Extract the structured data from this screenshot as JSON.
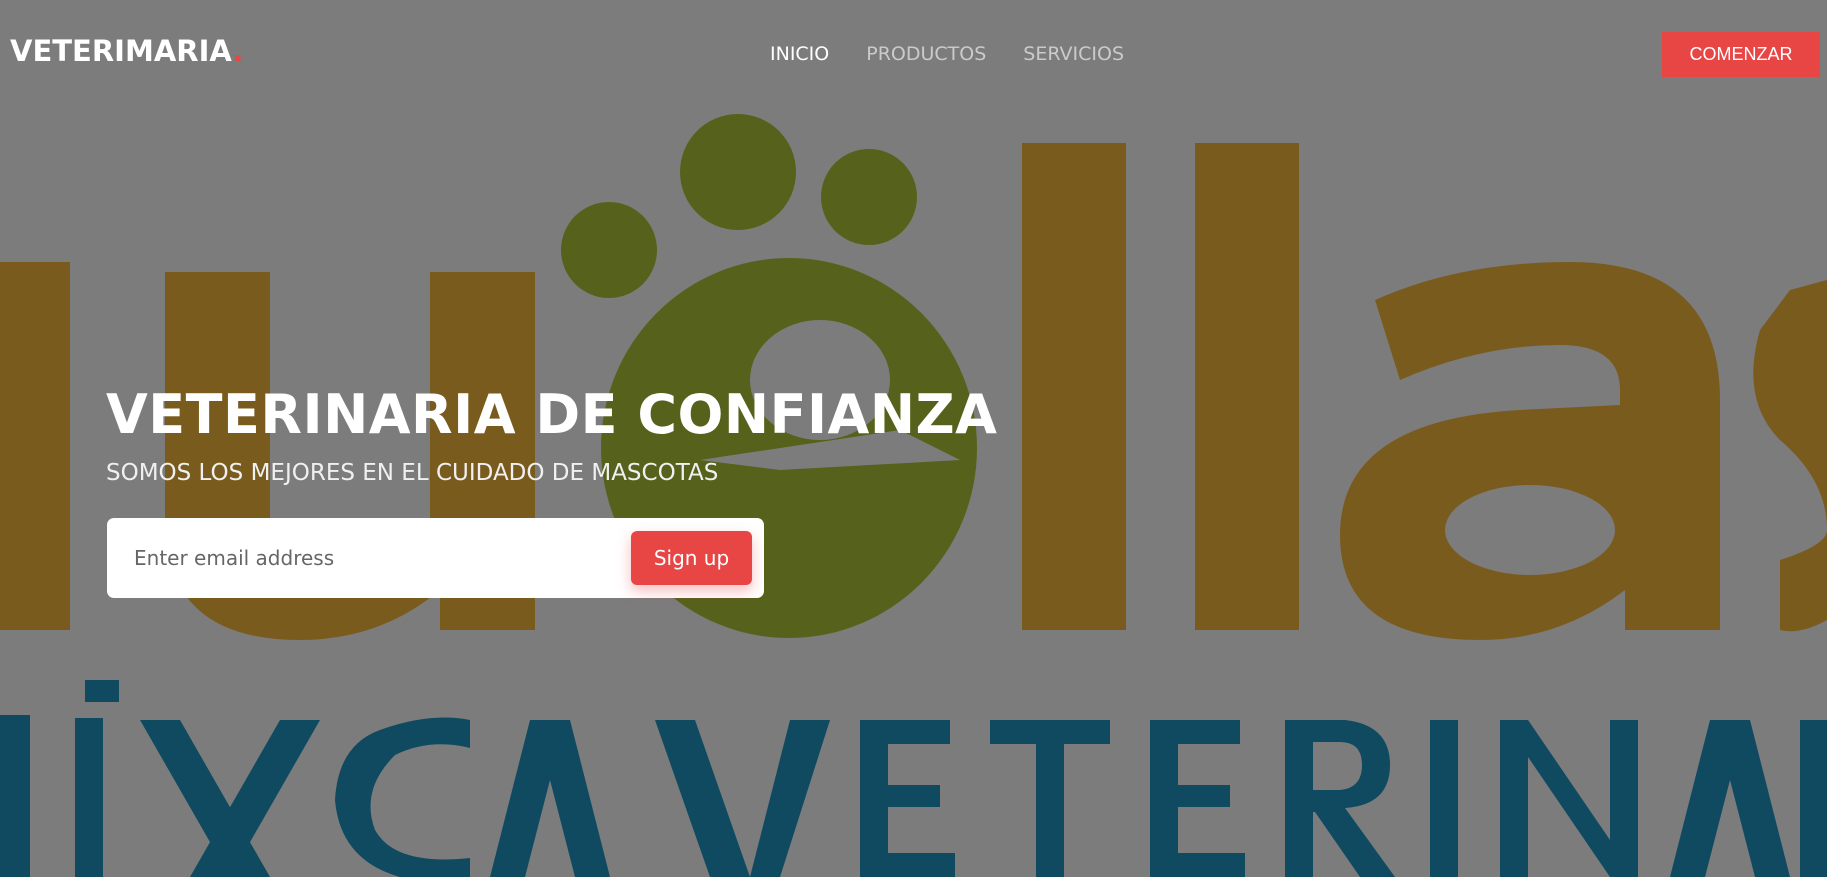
{
  "navbar": {
    "brand": "VETERIMARIA",
    "brand_dot": ".",
    "links": [
      {
        "label": "INICIO",
        "active": true
      },
      {
        "label": "PRODUCTOS",
        "active": false
      },
      {
        "label": "SERVICIOS",
        "active": false
      }
    ],
    "cta_label": "COMENZAR"
  },
  "hero": {
    "title": "VETERINARIA DE CONFIANZA",
    "subtitle": "SOMOS LOS MEJORES EN EL CUIDADO DE MASCOTAS",
    "email_placeholder": "Enter email address",
    "signup_label": "Sign up"
  },
  "background": {
    "logo_word": "huellas",
    "logo_tagline": "CLÍNICA VETERINARIA"
  },
  "colors": {
    "accent": "#e84545",
    "logo_orange": "#7a5b1e",
    "logo_green": "#56621b",
    "logo_blue": "#0f4a60"
  }
}
